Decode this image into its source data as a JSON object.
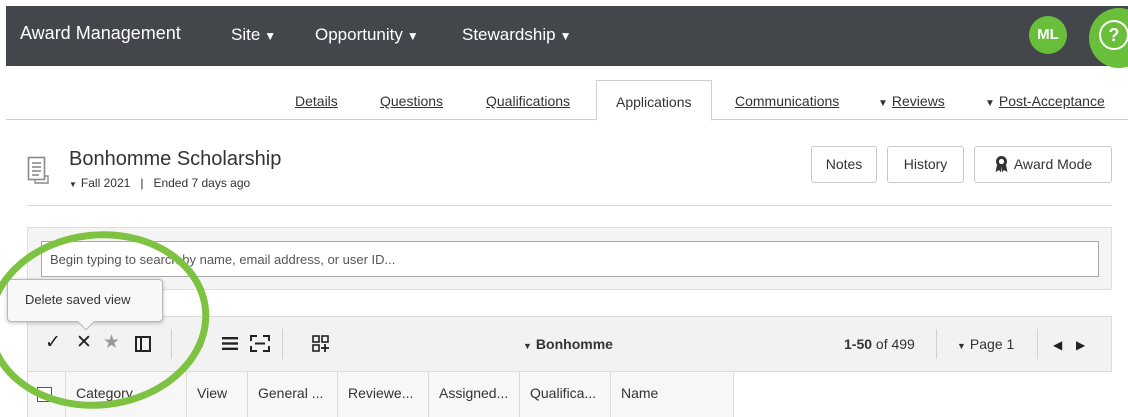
{
  "app": {
    "title": "Award Management",
    "nav": [
      {
        "label": "Site",
        "icon": "caret-down-icon"
      },
      {
        "label": "Opportunity",
        "icon": "caret-down-icon"
      },
      {
        "label": "Stewardship",
        "icon": "caret-down-icon"
      }
    ],
    "user_initials": "ML",
    "help_icon": "help-circle-icon",
    "accent_color": "#6abf3a",
    "nav_background": "#43464b"
  },
  "tabs": [
    {
      "label": "Details",
      "active": false
    },
    {
      "label": "Questions",
      "active": false
    },
    {
      "label": "Qualifications",
      "active": false
    },
    {
      "label": "Applications",
      "active": true
    },
    {
      "label": "Communications",
      "active": false
    },
    {
      "label": "Reviews",
      "active": false,
      "dropdown": true
    },
    {
      "label": "Post-Acceptance",
      "active": false,
      "dropdown": true
    }
  ],
  "opportunity": {
    "title": "Bonhomme Scholarship",
    "cycle": "Fall 2021",
    "separator": "|",
    "status": "Ended 7 days ago",
    "icon": "document-list-icon"
  },
  "actions": {
    "notes": "Notes",
    "history": "History",
    "award_mode": "Award Mode",
    "award_mode_icon": "ribbon-icon"
  },
  "search": {
    "placeholder": "Begin typing to search by name, email address, or user ID..."
  },
  "tooltip": {
    "text": "Delete saved view"
  },
  "toolbar": {
    "icons": [
      "check-icon",
      "close-icon",
      "star-icon",
      "columns-icon",
      "sort-icon",
      "list-icon",
      "expand-icon",
      "add-grid-icon"
    ],
    "view_name": "Bonhomme",
    "range": "1-50",
    "of_label": "of 499",
    "page_label": "Page 1",
    "prev_icon": "prev-arrow-icon",
    "next_icon": "next-arrow-icon"
  },
  "grid": {
    "columns": [
      "Category",
      "View",
      "General ...",
      "Reviewe...",
      "Assigned...",
      "Qualifica...",
      "Name"
    ]
  }
}
